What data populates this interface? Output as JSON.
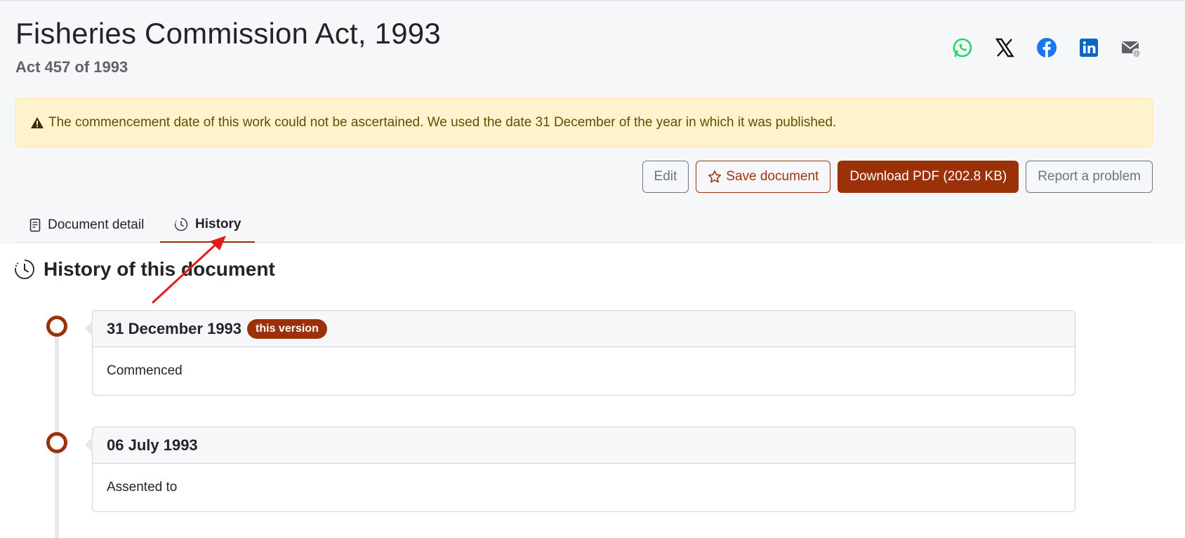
{
  "document": {
    "title": "Fisheries Commission Act, 1993",
    "subtitle": "Act 457 of 1993"
  },
  "share": [
    "whatsapp-icon",
    "x-icon",
    "facebook-icon",
    "linkedin-icon",
    "email-icon"
  ],
  "alert": {
    "icon": "warning-icon",
    "text": "The commencement date of this work could not be ascertained. We used the date 31 December of the year in which it was published."
  },
  "actions": {
    "edit": "Edit",
    "save": "Save document",
    "download": "Download PDF (202.8 KB)",
    "report": "Report a problem"
  },
  "tabs": {
    "document_detail": "Document detail",
    "history": "History"
  },
  "history": {
    "title": "History of this document",
    "entries": [
      {
        "date": "31 December 1993",
        "badge": "this version",
        "event": "Commenced"
      },
      {
        "date": "06 July 1993",
        "badge": "",
        "event": "Assented to"
      }
    ]
  },
  "colors": {
    "accent": "#9b3108",
    "alert_bg": "#fff3cd",
    "alert_text": "#664d03",
    "annotation_arrow": "#e11b1b"
  }
}
